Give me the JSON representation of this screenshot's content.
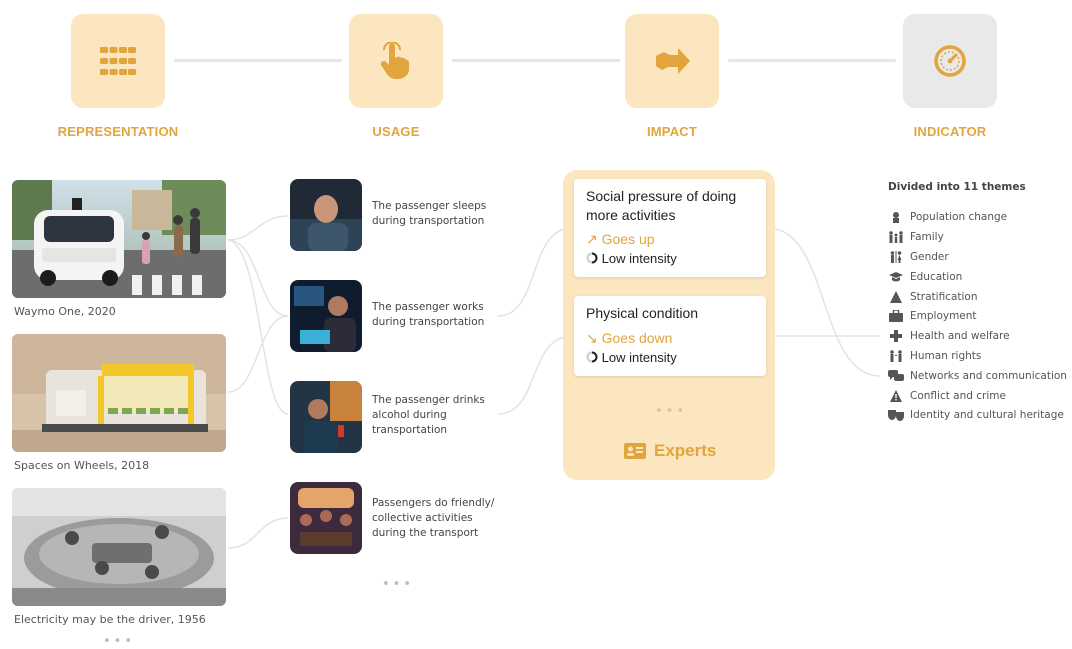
{
  "stages": [
    {
      "label": "REPRESENTATION",
      "icon": "grid-icon"
    },
    {
      "label": "USAGE",
      "icon": "hand-pointer-icon"
    },
    {
      "label": "IMPACT",
      "icon": "arrow-right-icon"
    },
    {
      "label": "INDICATOR",
      "icon": "gauge-icon"
    }
  ],
  "representation": [
    {
      "caption": "Waymo One, 2020"
    },
    {
      "caption": "Spaces on Wheels, 2018"
    },
    {
      "caption": "Electricity may be the driver, 1956"
    }
  ],
  "usage": [
    {
      "text": "The passenger sleeps during transportation"
    },
    {
      "text": "The passenger works during transportation"
    },
    {
      "text": "The passenger drinks alcohol during transportation"
    },
    {
      "text": "Passengers do friendly/ collective activities during the transport"
    }
  ],
  "more": "•••",
  "impacts": [
    {
      "title": "Social pressure of doing more activities",
      "trend": "Goes up",
      "trend_symbol": "↗",
      "intensity": "Low intensity"
    },
    {
      "title": "Physical condition",
      "trend": "Goes down",
      "trend_symbol": "↘",
      "intensity": "Low intensity"
    }
  ],
  "experts_label": "Experts",
  "indicator": {
    "heading": "Divided into 11 themes",
    "themes": [
      {
        "label": "Population change",
        "icon": "population-icon"
      },
      {
        "label": "Family",
        "icon": "family-icon"
      },
      {
        "label": "Gender",
        "icon": "gender-icon"
      },
      {
        "label": "Education",
        "icon": "graduation-cap-icon"
      },
      {
        "label": "Stratification",
        "icon": "pyramid-icon"
      },
      {
        "label": "Employment",
        "icon": "briefcase-icon"
      },
      {
        "label": "Health and welfare",
        "icon": "medical-cross-icon"
      },
      {
        "label": "Human rights",
        "icon": "people-icon"
      },
      {
        "label": "Networks and communication",
        "icon": "chat-bubbles-icon"
      },
      {
        "label": "Conflict and crime",
        "icon": "warning-icon"
      },
      {
        "label": "Identity and cultural heritage",
        "icon": "theater-masks-icon"
      }
    ]
  },
  "colors": {
    "accent": "#e2a43c",
    "panel": "#fbe6bf",
    "grey_box": "#e9e9e9"
  }
}
